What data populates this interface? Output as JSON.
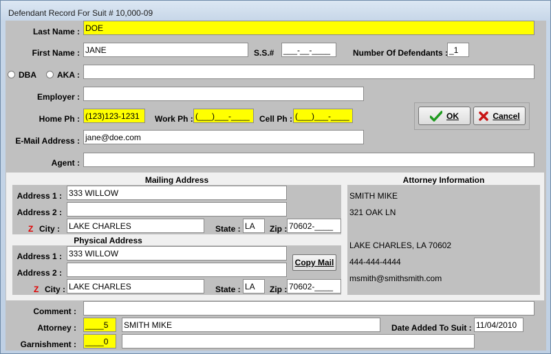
{
  "window": {
    "title": "Defendant Record For Suit # 10,000-09"
  },
  "labels": {
    "last_name": "Last Name :",
    "first_name": "First Name :",
    "ssn": "S.S.#",
    "num_defendants": "Number Of Defendants :",
    "dba": "DBA",
    "aka": "AKA :",
    "employer": "Employer :",
    "home_ph": "Home Ph :",
    "work_ph": "Work Ph :",
    "cell_ph": "Cell Ph :",
    "email": "E-Mail Address :",
    "agent": "Agent :",
    "comment": "Comment :",
    "attorney": "Attorney :",
    "garnishment": "Garnishment :",
    "date_added": "Date Added To Suit :"
  },
  "fields": {
    "last_name": "DOE",
    "first_name": "JANE",
    "ssn": "___-__-____",
    "num_defendants": "_1",
    "dba_aka": "",
    "employer": "",
    "home_ph": "(123)123-1231",
    "work_ph": "(___)___-____",
    "cell_ph": "(___)___-____",
    "email": "jane@doe.com",
    "agent": "",
    "comment": "",
    "attorney_id": "____5",
    "attorney_name": "SMITH MIKE",
    "garnishment_id": "____0",
    "garnishment_name": "",
    "date_added": "11/04/2010"
  },
  "buttons": {
    "ok": "OK",
    "cancel": "Cancel",
    "copy_mail": "Copy Mail"
  },
  "mailing": {
    "header": "Mailing Address",
    "address1_label": "Address 1 :",
    "address2_label": "Address 2 :",
    "city_label": "City :",
    "state_label": "State :",
    "zip_label": "Zip :",
    "required_mark": "Z",
    "address1": "333 WILLOW",
    "address2": "",
    "city": "LAKE CHARLES",
    "state": "LA",
    "zip": "70602-____"
  },
  "physical": {
    "header": "Physical Address",
    "address1_label": "Address 1 :",
    "address2_label": "Address 2 :",
    "city_label": "City :",
    "state_label": "State :",
    "zip_label": "Zip :",
    "required_mark": "Z",
    "address1": "333 WILLOW",
    "address2": "",
    "city": "LAKE CHARLES",
    "state": "LA",
    "zip": "70602-____"
  },
  "attorney_info": {
    "header": "Attorney Information",
    "name": "SMITH MIKE",
    "street": "321 OAK LN",
    "city_state_zip": "LAKE CHARLES, LA 70602",
    "phone": "444-444-4444",
    "email": "msmith@smithsmith.com"
  },
  "colors": {
    "highlight": "#ffff00",
    "ok_icon": "#1f9a1f",
    "cancel_icon": "#c81414",
    "required": "#e00000"
  }
}
